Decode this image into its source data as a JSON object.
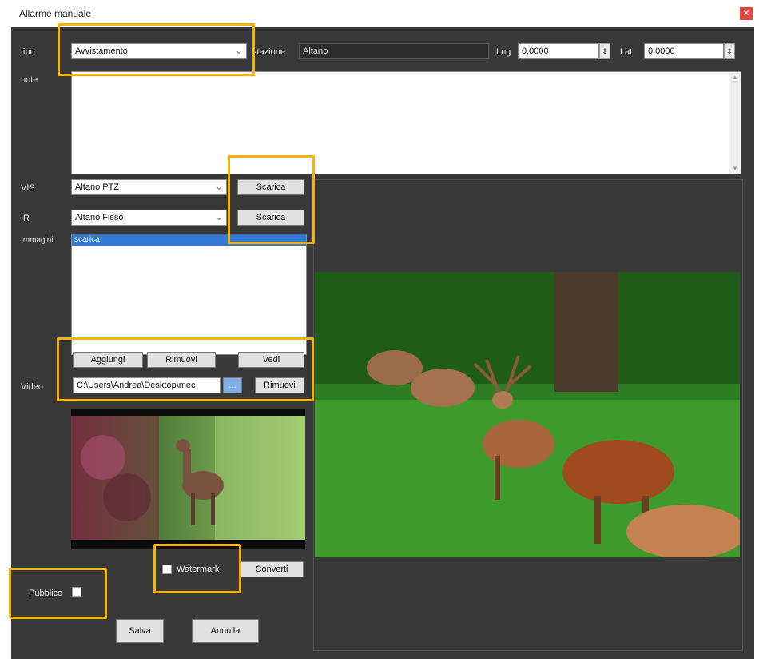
{
  "window": {
    "title": "Allarme manuale",
    "close_glyph": "✕"
  },
  "form": {
    "tipo": {
      "label": "tipo",
      "value": "Avvistamento"
    },
    "stazione": {
      "label": "stazione",
      "value": "Altano"
    },
    "lng": {
      "label": "Lng",
      "value": "0,0000"
    },
    "lat": {
      "label": "Lat",
      "value": "0,0000"
    },
    "note": {
      "label": "note"
    },
    "vis": {
      "label": "VIS",
      "value": "Altano PTZ",
      "button": "Scarica"
    },
    "ir": {
      "label": "IR",
      "value": "Altano Fisso",
      "button": "Scarica"
    },
    "immagini": {
      "label": "Immagini",
      "selected_item": "scarica"
    },
    "image_buttons": {
      "add": "Aggiungi",
      "remove": "Rimuovi",
      "view": "Vedi"
    },
    "video": {
      "label": "Video",
      "path": "C:\\Users\\Andrea\\Desktop\\mec",
      "browse": "...",
      "remove": "Rimuovi"
    },
    "watermark": {
      "label": "Watermark",
      "convert": "Converti"
    },
    "pubblico": {
      "label": "Pubblico"
    },
    "footer": {
      "save": "Salva",
      "cancel": "Annulla"
    }
  },
  "icons": {
    "dropdown": "chevron-down-icon",
    "spinner": "spinner-arrows-icon"
  },
  "colors": {
    "window_bg": "#393939",
    "highlight": "#f4b400",
    "selection": "#3179d4"
  }
}
